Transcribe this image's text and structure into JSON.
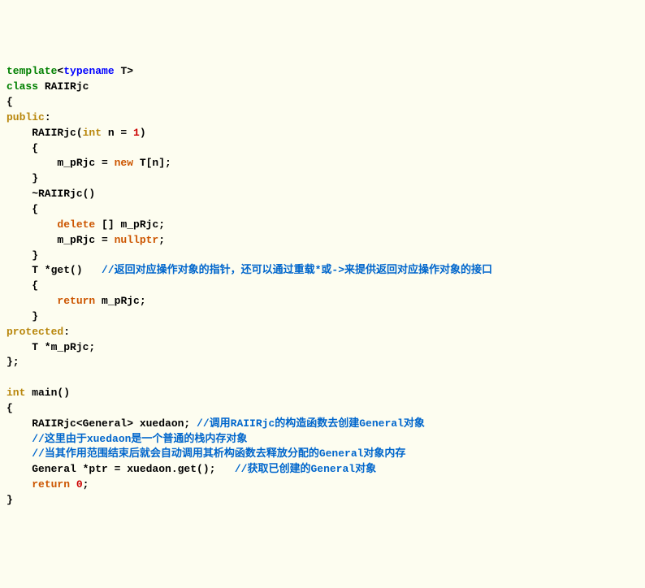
{
  "code": {
    "l01_template": "template",
    "l01_typename": "typename",
    "l01_T": " T",
    "l02_class": "class",
    "l02_name": " RAIIRjc",
    "l03": "{",
    "l04_public": "public",
    "l04_colon": ":",
    "l05_name": "    RAIIRjc(",
    "l05_int": "int",
    "l05_param": " n = ",
    "l05_one": "1",
    "l05_close": ")",
    "l06": "    {",
    "l07_pre": "        m_pRjc = ",
    "l07_new": "new",
    "l07_post": " T[n];",
    "l08": "    }",
    "l09": "    ~RAIIRjc()",
    "l10": "    {",
    "l11_ind": "        ",
    "l11_delete": "delete",
    "l11_post": " [] m_pRjc;",
    "l12_pre": "        m_pRjc = ",
    "l12_nullptr": "nullptr",
    "l12_semi": ";",
    "l13": "    }",
    "l14_pre": "    T *get()   ",
    "l14_comment": "//返回对应操作对象的指针，还可以通过重载*或->来提供返回对应操作对象的接口",
    "l15": "    {",
    "l16_ind": "        ",
    "l16_return": "return",
    "l16_post": " m_pRjc;",
    "l17": "    }",
    "l18_protected": "protected",
    "l18_colon": ":",
    "l19": "    T *m_pRjc;",
    "l20": "};",
    "l21": "",
    "l22_int": "int",
    "l22_main": " main()",
    "l23": "{",
    "l24_pre": "    RAIIRjc<General> xuedaon; ",
    "l24_comment": "//调用RAIIRjc的构造函数去创建General对象",
    "l25_ind": "    ",
    "l25_comment": "//这里由于xuedaon是一个普通的栈内存对象",
    "l26_ind": "    ",
    "l26_comment": "//当其作用范围结束后就会自动调用其析构函数去释放分配的General对象内存",
    "l27_pre": "    General *ptr = xuedaon.get();   ",
    "l27_comment": "//获取已创建的General对象",
    "l28_ind": "    ",
    "l28_return": "return",
    "l28_sp": " ",
    "l28_zero": "0",
    "l28_semi": ";",
    "l29": "}"
  }
}
